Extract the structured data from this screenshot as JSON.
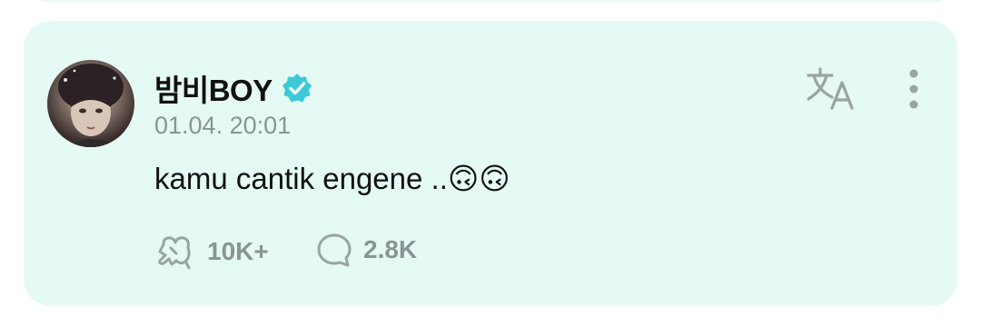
{
  "post": {
    "author": "밤비BOY",
    "verified": true,
    "timestamp": "01.04. 20:01",
    "message": "kamu cantik engene ..🙃🙃",
    "likes": "10K+",
    "comments": "2.8K"
  },
  "icons": {
    "avatar": "avatar",
    "verified": "verified-badge-icon",
    "translate": "translate-icon",
    "more": "more-vertical-icon",
    "like": "heart-hand-icon",
    "comment": "comment-bubble-icon"
  },
  "colors": {
    "card_background": "#e5f9f5",
    "verified_badge": "#3cc9d6",
    "muted_text": "#8a9494",
    "icon_gray": "#9aa3a3"
  }
}
